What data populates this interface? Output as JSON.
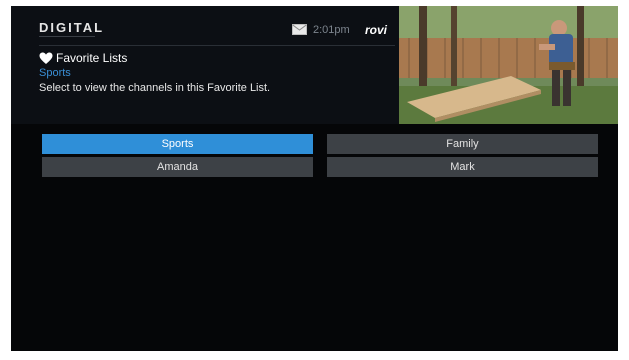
{
  "header": {
    "logo": "DIGITAL",
    "time": "2:01pm",
    "brand": "rovi"
  },
  "panel": {
    "title": "Favorite Lists",
    "subtitle": "Sports",
    "description": "Select to view the channels in this Favorite List."
  },
  "lists": [
    {
      "label": "Sports"
    },
    {
      "label": "Family"
    },
    {
      "label": "Amanda"
    },
    {
      "label": "Mark"
    }
  ],
  "icons": {
    "mail": "mail-icon",
    "heart": "heart-icon"
  },
  "colors": {
    "selected": "#2f8fd8",
    "tile": "#3d4146",
    "subtitle": "#3a8fd6",
    "background": "#050608"
  }
}
